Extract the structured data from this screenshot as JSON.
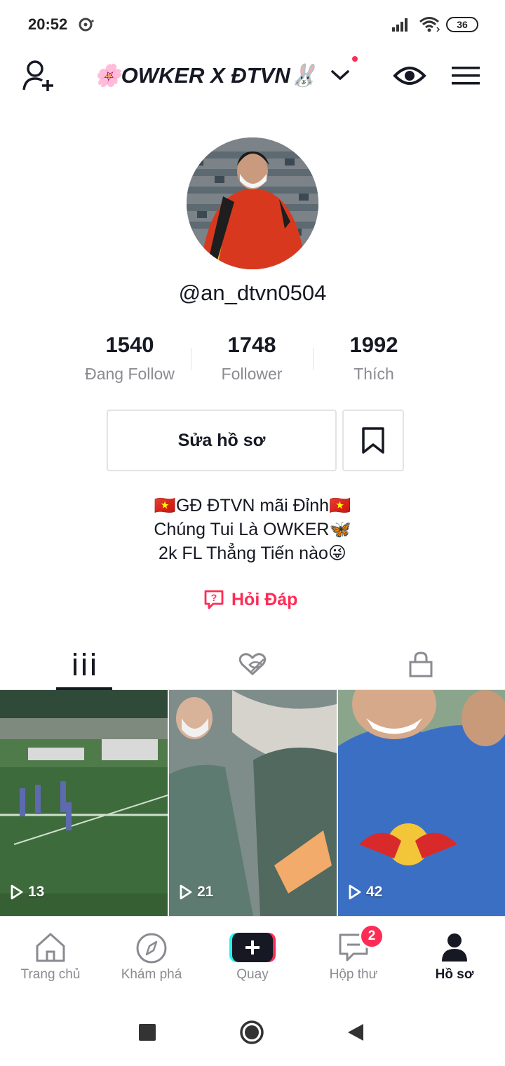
{
  "status_bar": {
    "time": "20:52",
    "battery": "36"
  },
  "header": {
    "profile_name": "🌸OWKER X ĐTVN🐰"
  },
  "profile": {
    "username": "@an_dtvn0504",
    "stats": [
      {
        "value": "1540",
        "label": "Đang Follow"
      },
      {
        "value": "1748",
        "label": "Follower"
      },
      {
        "value": "1992",
        "label": "Thích"
      }
    ],
    "edit_button": "Sửa hồ sơ",
    "bio": [
      "🇻🇳GĐ ĐTVN mãi Đỉnh🇻🇳",
      "Chúng Tui Là OWKER🦋",
      "2k FL Thẳng Tiến nào😜"
    ],
    "qa_link": "Hỏi Đáp"
  },
  "tabs": [
    {
      "icon": "grid-videos-icon",
      "active": true
    },
    {
      "icon": "liked-hidden-icon",
      "active": false
    },
    {
      "icon": "lock-icon",
      "active": false
    }
  ],
  "videos": [
    {
      "views": "13"
    },
    {
      "views": "21"
    },
    {
      "views": "42"
    }
  ],
  "bottom_nav": [
    {
      "label": "Trang chủ",
      "icon": "home-icon"
    },
    {
      "label": "Khám phá",
      "icon": "compass-icon"
    },
    {
      "label": "Quay",
      "icon": "create-plus-icon"
    },
    {
      "label": "Hộp thư",
      "icon": "inbox-icon",
      "badge": "2"
    },
    {
      "label": "Hồ sơ",
      "icon": "profile-icon",
      "active": true
    }
  ],
  "colors": {
    "accent": "#fe2c55",
    "text": "#161823",
    "muted": "#8a8b91"
  }
}
